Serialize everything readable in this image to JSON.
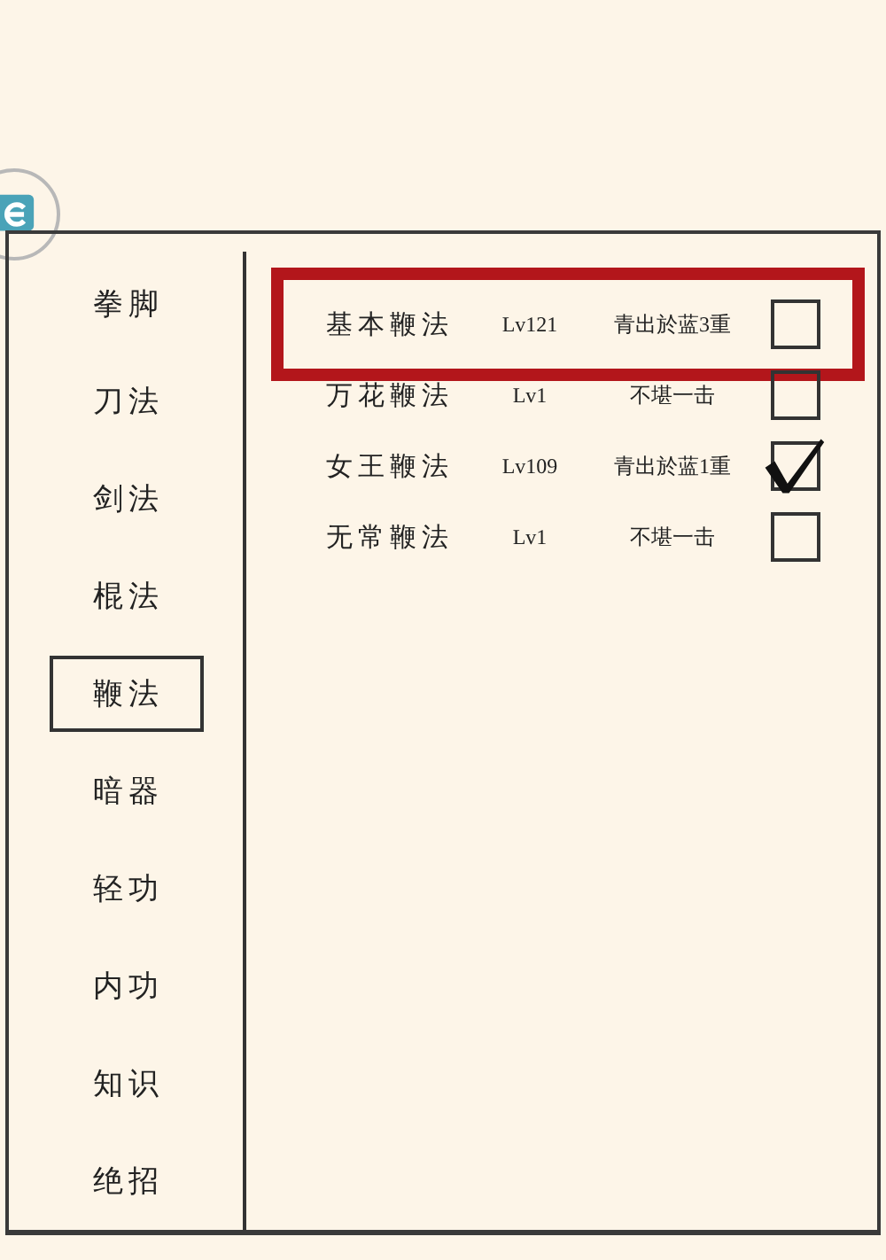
{
  "categories": [
    {
      "label": "拳脚",
      "selected": false
    },
    {
      "label": "刀法",
      "selected": false
    },
    {
      "label": "剑法",
      "selected": false
    },
    {
      "label": "棍法",
      "selected": false
    },
    {
      "label": "鞭法",
      "selected": true
    },
    {
      "label": "暗器",
      "selected": false
    },
    {
      "label": "轻功",
      "selected": false
    },
    {
      "label": "内功",
      "selected": false
    },
    {
      "label": "知识",
      "selected": false
    },
    {
      "label": "绝招",
      "selected": false
    }
  ],
  "skills": [
    {
      "name": "基本鞭法",
      "level": "Lv121",
      "rank": "青出於蓝3重",
      "checked": false,
      "highlighted": true
    },
    {
      "name": "万花鞭法",
      "level": "Lv1",
      "rank": "不堪一击",
      "checked": false,
      "highlighted": false
    },
    {
      "name": "女王鞭法",
      "level": "Lv109",
      "rank": "青出於蓝1重",
      "checked": true,
      "highlighted": false
    },
    {
      "name": "无常鞭法",
      "level": "Lv1",
      "rank": "不堪一击",
      "checked": false,
      "highlighted": false
    }
  ]
}
